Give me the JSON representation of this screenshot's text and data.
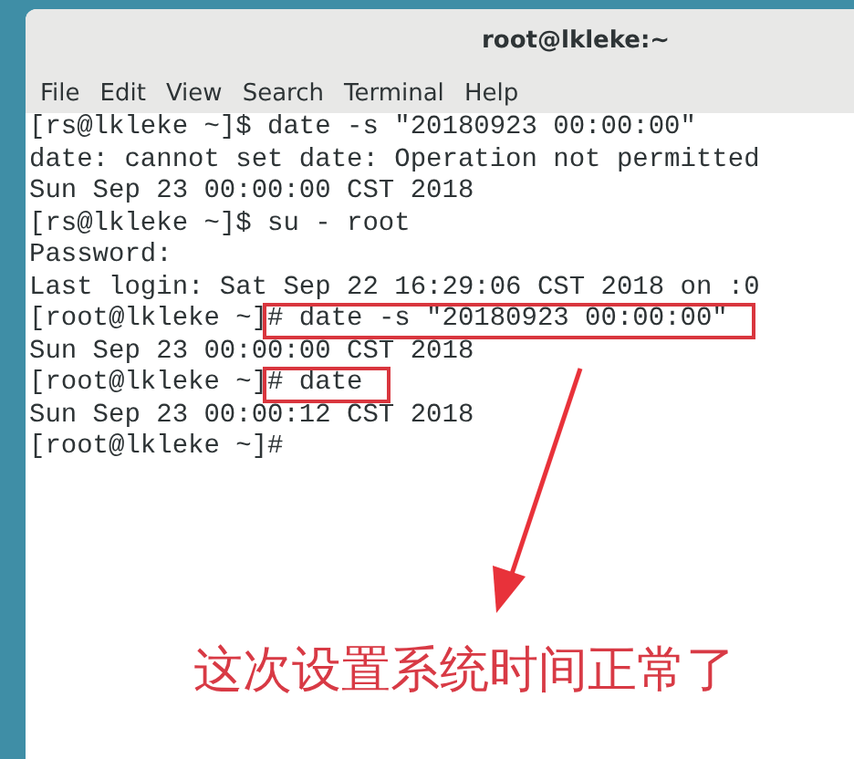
{
  "window": {
    "title": "root@lkleke:~"
  },
  "menu": [
    "File",
    "Edit",
    "View",
    "Search",
    "Terminal",
    "Help"
  ],
  "lines": [
    {
      "kind": "input",
      "prompt": "[rs@lkleke ~]",
      "command": "$ date -s \"20180923 00:00:00\"",
      "boxed": false
    },
    {
      "kind": "output",
      "text": "date: cannot set date: Operation not permitted"
    },
    {
      "kind": "output",
      "text": "Sun Sep 23 00:00:00 CST 2018"
    },
    {
      "kind": "input",
      "prompt": "[rs@lkleke ~]",
      "command": "$ su - root",
      "boxed": false
    },
    {
      "kind": "output",
      "text": "Password:"
    },
    {
      "kind": "output",
      "text": "Last login: Sat Sep 22 16:29:06 CST 2018 on :0"
    },
    {
      "kind": "input",
      "prompt": "[root@lkleke ~]",
      "command": "# date -s \"20180923 00:00:00\"",
      "boxed": true
    },
    {
      "kind": "output",
      "text": "Sun Sep 23 00:00:00 CST 2018"
    },
    {
      "kind": "input",
      "prompt": "[root@lkleke ~]",
      "command": "# date",
      "boxed": true
    },
    {
      "kind": "output",
      "text": "Sun Sep 23 00:00:12 CST 2018"
    },
    {
      "kind": "input",
      "prompt": "[root@lkleke ~]",
      "command": "#",
      "boxed": false
    }
  ],
  "annotation": {
    "caption": "这次设置系统时间正常了"
  }
}
